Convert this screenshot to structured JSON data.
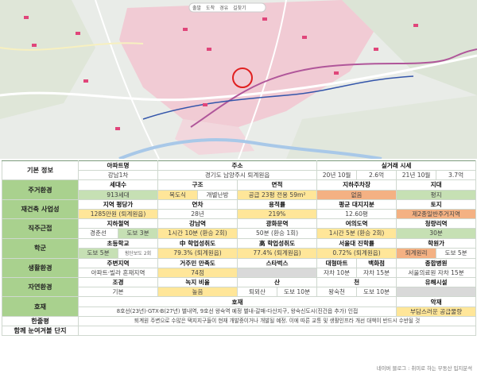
{
  "map": {
    "top_labels": [
      "출발",
      "도착",
      "경유",
      "길찾기"
    ],
    "colors": {
      "magenta_line": "#b0569a",
      "blue_line": "#3355aa",
      "highlight_circle": "#e02020",
      "pink_zone": "#f2c6d0"
    }
  },
  "rows": {
    "basic": {
      "category": "기본 정보",
      "h1": "아파트명",
      "h2": "주소",
      "h3": "실거래 시세",
      "name": "강남1차",
      "address": "경기도 남양주시 퇴계원읍",
      "price1_date": "20년 10월",
      "price1_value": "2.6억",
      "price2_date": "21년 10월",
      "price2_value": "3.7억"
    },
    "living": {
      "category": "주거환경",
      "h1": "세대수",
      "h2": "구조",
      "h3": "면적",
      "h4": "지하주차장",
      "h5": "지대",
      "households": "913세대",
      "structure1": "복도식",
      "structure2": "개별난방",
      "area": "공급 23평  전용 59m²",
      "parking": "없음",
      "terrain": "평지"
    },
    "rebuild": {
      "category": "재건축 사업성",
      "h1": "지역 평당가",
      "h2": "연차",
      "h3": "용적률",
      "h4": "평균 대지지분",
      "h5": "토지",
      "price_per_pyeong": "1285만원 (퇴계원읍)",
      "age": "28년",
      "far": "219%",
      "land_share": "12.60평",
      "land": "제2종일반주거지역"
    },
    "commute": {
      "category": "직주근접",
      "h1": "지하철역",
      "h2": "강남역",
      "h3": "광화문역",
      "h4": "여의도역",
      "h5": "청량리역",
      "station1": "경춘선",
      "station2": "도보 3분",
      "gangnam": "1시간 10분 (환승 2회)",
      "gwanghwamun": "50분 (환승 1회)",
      "yeouido": "1시간 5분 (환승 2회)",
      "cheongnyangni": "30분"
    },
    "school": {
      "category": "학군",
      "h1": "초등학교",
      "h2": "中 학업성취도",
      "h3": "高 학업성취도",
      "h4": "서울대 진학률",
      "h5": "학원가",
      "elem1": "도보 5분",
      "elem_note": "횡단보도 2회",
      "middle": "79.3% (퇴계원읍)",
      "high": "77.4% (퇴계원읍)",
      "snu": "0.72% (퇴계원읍)",
      "academy1": "퇴계원리",
      "academy2": "도보 5분"
    },
    "life": {
      "category": "생활환경",
      "h1": "주변지역",
      "h2": "거주민 만족도",
      "h3": "스타벅스",
      "h4a": "대형마트",
      "h4b": "백화점",
      "h5": "종합병원",
      "surrounding": "아파트·빌라 혼재지역",
      "satisfaction": "74점",
      "starbucks": "",
      "mart": "자차 10분",
      "dept": "자차 15분",
      "hospital": "서울의료원  자차 15분"
    },
    "nature": {
      "category": "자연환경",
      "h1": "조경",
      "h2": "녹지 비율",
      "h3": "산",
      "h4": "천",
      "h5": "유해시설",
      "landscape": "기본",
      "green": "높음",
      "mountain1": "퇴뫼산",
      "mountain2": "도보 10분",
      "stream1": "왕숙천",
      "stream2": "도보 10분",
      "hazard": ""
    },
    "factors": {
      "category": "호재",
      "h_good": "호재",
      "h_bad": "악재",
      "good": "8호선(23년)·GTX-B(27년) 별내역, 9호선 왕숙역 예정   별내-갈매-다산지구, 왕숙신도시(진건읍 추가) 인접",
      "bad": "부담스러운 공급물량"
    },
    "summary": {
      "category": "한줄평",
      "text": "퇴계원 주변으로 수많은 택지지구들이 현재 개발중이거나 개발될 예정. 이에 따른 교통 및 생활인프라 개선 대책이 반드시 수반될 것"
    },
    "compare": {
      "category": "함께 눈여겨볼 단지",
      "text": ""
    }
  },
  "footer": "네이버 블로그 : 취미로 하는 부동산 입지분석"
}
